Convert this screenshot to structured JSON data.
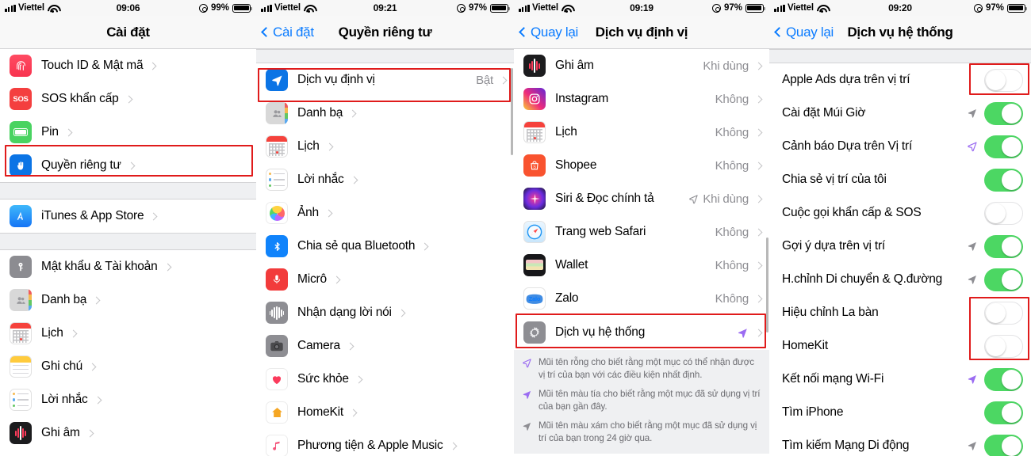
{
  "panels": [
    {
      "id": "settings",
      "status": {
        "carrier": "Viettel",
        "time": "09:06",
        "battery": "99%"
      },
      "nav": {
        "back": null,
        "title": "Cài đặt"
      },
      "rows": [
        {
          "label": "Touch ID & Mật mã",
          "icon": "touchid-icon",
          "type": "chevron"
        },
        {
          "label": "SOS khẩn cấp",
          "icon": "sos-icon",
          "type": "chevron"
        },
        {
          "label": "Pin",
          "icon": "battery-icon",
          "type": "chevron"
        },
        {
          "label": "Quyền riêng tư",
          "icon": "privacy-hand-icon",
          "type": "chevron",
          "highlight": true
        },
        {
          "gap": true
        },
        {
          "label": "iTunes & App Store",
          "icon": "appstore-icon",
          "type": "chevron"
        },
        {
          "gap": true
        },
        {
          "label": "Mật khẩu & Tài khoản",
          "icon": "key-icon",
          "type": "chevron"
        },
        {
          "label": "Danh bạ",
          "icon": "contacts-icon",
          "type": "chevron"
        },
        {
          "label": "Lịch",
          "icon": "calendar-icon",
          "type": "chevron"
        },
        {
          "label": "Ghi chú",
          "icon": "notes-icon",
          "type": "chevron"
        },
        {
          "label": "Lời nhắc",
          "icon": "reminders-icon",
          "type": "chevron"
        },
        {
          "label": "Ghi âm",
          "icon": "voicememos-icon",
          "type": "chevron"
        }
      ]
    },
    {
      "id": "privacy",
      "status": {
        "carrier": "Viettel",
        "time": "09:21",
        "battery": "97%"
      },
      "nav": {
        "back": "Cài đặt",
        "title": "Quyền riêng tư"
      },
      "rows": [
        {
          "gap": true
        },
        {
          "label": "Dịch vụ định vị",
          "icon": "location-arrow-icon",
          "value": "Bật",
          "type": "chevron",
          "highlight": true
        },
        {
          "label": "Danh bạ",
          "icon": "contacts-icon",
          "type": "chevron"
        },
        {
          "label": "Lịch",
          "icon": "calendar-icon",
          "type": "chevron"
        },
        {
          "label": "Lời nhắc",
          "icon": "reminders-icon",
          "type": "chevron"
        },
        {
          "label": "Ảnh",
          "icon": "photos-icon",
          "type": "chevron"
        },
        {
          "label": "Chia sẻ qua Bluetooth",
          "icon": "bluetooth-icon",
          "type": "chevron"
        },
        {
          "label": "Micrô",
          "icon": "microphone-icon",
          "type": "chevron"
        },
        {
          "label": "Nhận dạng lời nói",
          "icon": "speech-recognition-icon",
          "type": "chevron"
        },
        {
          "label": "Camera",
          "icon": "camera-icon",
          "type": "chevron"
        },
        {
          "label": "Sức khỏe",
          "icon": "health-heart-icon",
          "type": "chevron"
        },
        {
          "label": "HomeKit",
          "icon": "homekit-house-icon",
          "type": "chevron"
        },
        {
          "label": "Phương tiện & Apple Music",
          "icon": "music-icon",
          "type": "chevron"
        }
      ]
    },
    {
      "id": "location-services",
      "status": {
        "carrier": "Viettel",
        "time": "09:19",
        "battery": "97%"
      },
      "nav": {
        "back": "Quay lại",
        "title": "Dịch vụ định vị"
      },
      "rows": [
        {
          "label": "Ghi âm",
          "icon": "voicememos-icon",
          "value": "Khi dùng",
          "type": "chevron"
        },
        {
          "label": "Instagram",
          "icon": "instagram-icon",
          "value": "Không",
          "type": "chevron"
        },
        {
          "label": "Lịch",
          "icon": "calendar-icon",
          "value": "Không",
          "type": "chevron"
        },
        {
          "label": "Shopee",
          "icon": "shopee-icon",
          "value": "Không",
          "type": "chevron"
        },
        {
          "label": "Siri & Đọc chính tả",
          "icon": "siri-icon",
          "value": "Khi dùng",
          "type": "chevron",
          "arrow": "hollow"
        },
        {
          "label": "Trang web Safari",
          "icon": "safari-icon",
          "value": "Không",
          "type": "chevron"
        },
        {
          "label": "Wallet",
          "icon": "wallet-icon",
          "value": "Không",
          "type": "chevron"
        },
        {
          "label": "Zalo",
          "icon": "zalo-icon",
          "value": "Không",
          "type": "chevron"
        },
        {
          "label": "Dịch vụ hệ thống",
          "icon": "system-services-gear-icon",
          "type": "chevron",
          "arrow": "purple",
          "highlight": true
        }
      ],
      "notes": [
        {
          "arrow": "hollow",
          "text": "Mũi tên rỗng cho biết rằng một mục có thể nhận được vị trí của bạn với các điều kiện nhất định."
        },
        {
          "arrow": "purple",
          "text": "Mũi tên màu tía cho biết rằng một mục đã sử dụng vị trí của bạn gần đây."
        },
        {
          "arrow": "gray",
          "text": "Mũi tên màu xám cho biết rằng một mục đã sử dụng vị trí của bạn trong 24 giờ qua."
        }
      ]
    },
    {
      "id": "system-services",
      "status": {
        "carrier": "Viettel",
        "time": "09:20",
        "battery": "97%"
      },
      "nav": {
        "back": "Quay lại",
        "title": "Dịch vụ hệ thống"
      },
      "rows": [
        {
          "gap": true
        },
        {
          "label": "Apple Ads dựa trên vị trí",
          "toggle": "off",
          "highlight": true
        },
        {
          "label": "Cài đặt Múi Giờ",
          "toggle": "on",
          "arrow": "gray"
        },
        {
          "label": "Cảnh báo Dựa trên Vị trí",
          "toggle": "on",
          "arrow": "hollow"
        },
        {
          "label": "Chia sẻ vị trí của tôi",
          "toggle": "on"
        },
        {
          "label": "Cuộc gọi khẩn cấp & SOS",
          "toggle": "off"
        },
        {
          "label": "Gợi ý dựa trên vị trí",
          "toggle": "on",
          "arrow": "gray"
        },
        {
          "label": "H.chỉnh Di chuyển & Q.đường",
          "toggle": "on",
          "arrow": "gray"
        },
        {
          "label": "Hiệu chỉnh La bàn",
          "toggle": "off",
          "highlight": true
        },
        {
          "label": "HomeKit",
          "toggle": "off",
          "highlight": true
        },
        {
          "label": "Kết nối mạng Wi-Fi",
          "toggle": "on",
          "arrow": "purple"
        },
        {
          "label": "Tìm iPhone",
          "toggle": "on"
        },
        {
          "label": "Tìm kiếm Mạng Di động",
          "toggle": "on",
          "arrow": "gray"
        }
      ]
    }
  ],
  "colors": {
    "highlight": "#e01b1b",
    "toggle_on": "#4cd763",
    "accent_blue": "#0a7bff",
    "value_gray": "#8e8e93",
    "group_bg": "#eff0f2",
    "purple_arrow": "#9b6cf2",
    "gray_arrow": "#8e8e93"
  }
}
